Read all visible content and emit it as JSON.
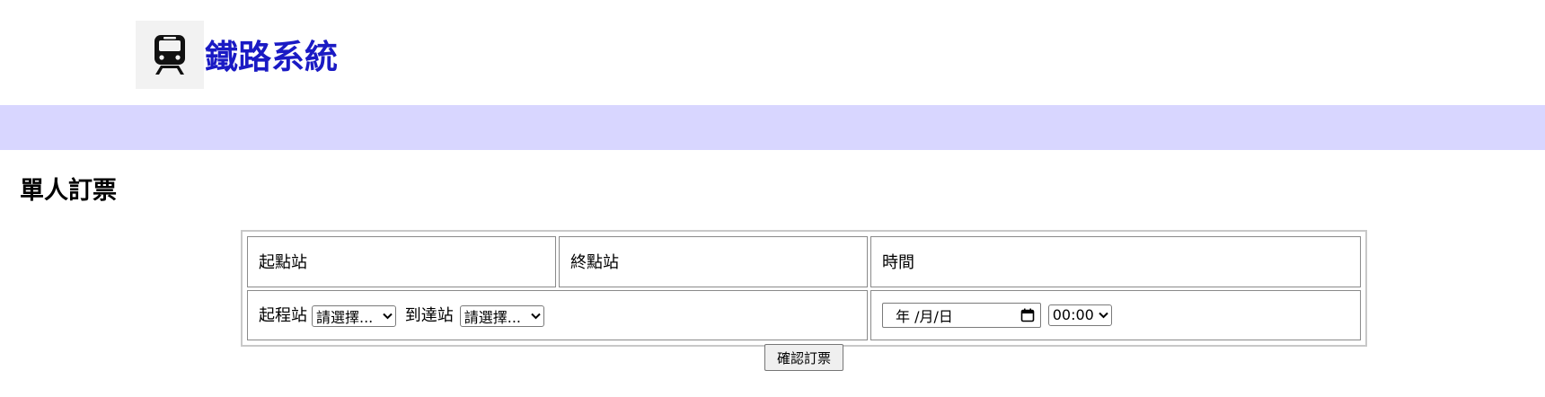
{
  "header": {
    "logo_icon": "train-icon",
    "title": "鐵路系統",
    "title_color": "#1a1ac4"
  },
  "navbar": {
    "background_color": "#d8d6ff"
  },
  "page": {
    "heading": "單人訂票"
  },
  "booking_form": {
    "columns": [
      "起點站",
      "終點站",
      "時間"
    ],
    "origin_label": "起程站",
    "origin_select_value": "請選擇...",
    "destination_label": "到達站",
    "destination_select_value": "請選擇...",
    "date_value": "年 /月/日",
    "date_icon": "calendar-icon",
    "time_select_value": "00:00",
    "submit_label": "確認訂票"
  }
}
